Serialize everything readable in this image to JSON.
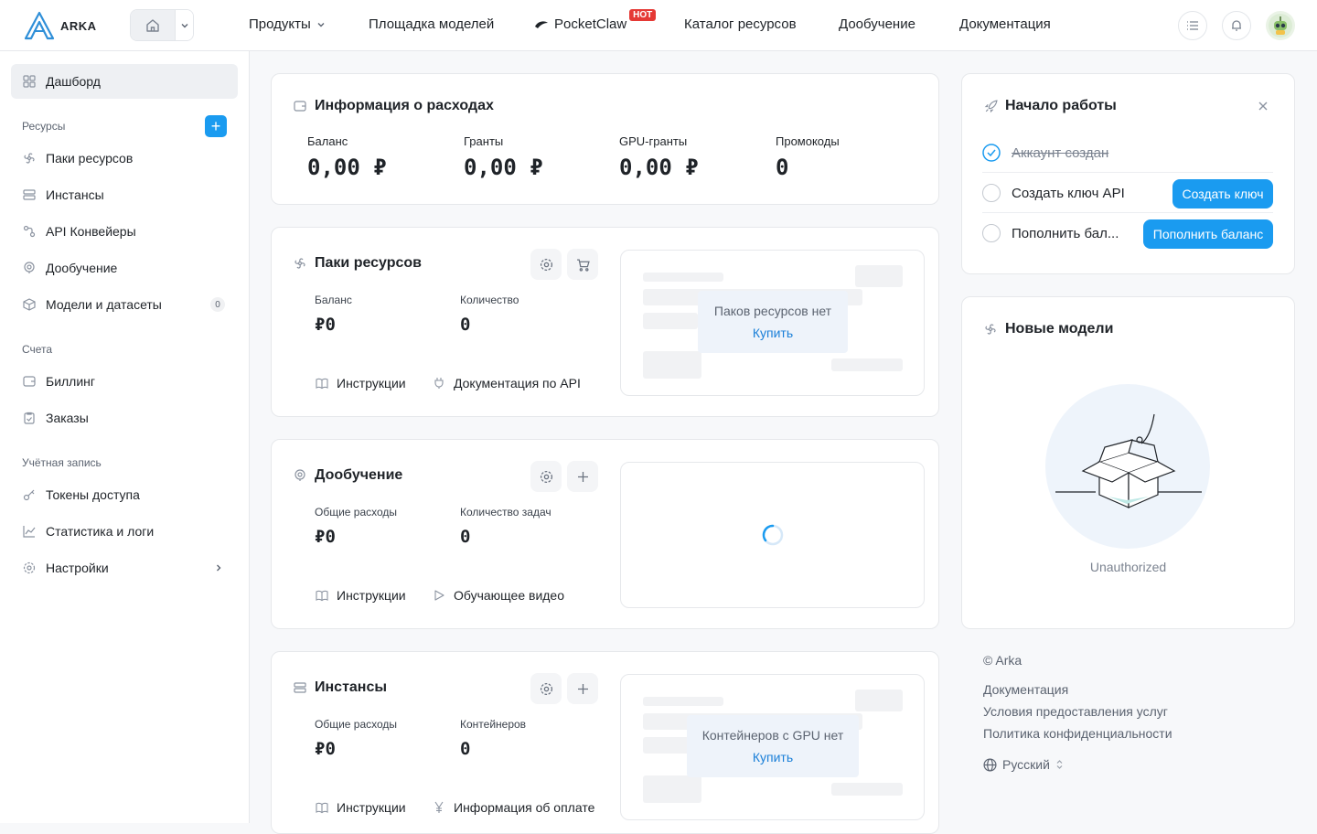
{
  "brand": {
    "name": "ARKA",
    "accent": "#1a9bf0"
  },
  "nav": {
    "products": "Продукты",
    "models": "Площадка моделей",
    "pocketclaw": "PocketClaw",
    "hot": "HOT",
    "catalog": "Каталог ресурсов",
    "finetune": "Дообучение",
    "docs": "Документация"
  },
  "sidebar": {
    "dashboard": "Дашборд",
    "resources_section": "Ресурсы",
    "resource_packs": "Паки ресурсов",
    "instances": "Инстансы",
    "api_pipelines": "API Конвейеры",
    "finetune": "Дообучение",
    "models_datasets": "Модели и датасеты",
    "models_count": "0",
    "accounts_section": "Счета",
    "billing": "Биллинг",
    "orders": "Заказы",
    "account_section": "Учётная запись",
    "tokens": "Токены доступа",
    "stats": "Статистика и логи",
    "settings": "Настройки"
  },
  "expenses": {
    "title": "Информация о расходах",
    "balance_label": "Баланс",
    "balance": "0,00 ₽",
    "grants_label": "Гранты",
    "grants": "0,00 ₽",
    "gpu_grants_label": "GPU-гранты",
    "gpu_grants": "0,00 ₽",
    "promo_label": "Промокоды",
    "promo": "0"
  },
  "packs": {
    "title": "Паки ресурсов",
    "balance_label": "Баланс",
    "balance": "₽0",
    "count_label": "Количество",
    "count": "0",
    "instructions": "Инструкции",
    "api_docs": "Документация по API",
    "empty": "Паков ресурсов нет",
    "buy": "Купить"
  },
  "finetune": {
    "title": "Дообучение",
    "total_label": "Общие расходы",
    "total": "₽0",
    "tasks_label": "Количество задач",
    "tasks": "0",
    "instructions": "Инструкции",
    "video": "Обучающее видео"
  },
  "instances": {
    "title": "Инстансы",
    "total_label": "Общие расходы",
    "total": "₽0",
    "containers_label": "Контейнеров",
    "containers": "0",
    "instructions": "Инструкции",
    "payment_info": "Информация об оплате",
    "empty": "Контейнеров с GPU нет",
    "buy": "Купить"
  },
  "onboarding": {
    "title": "Начало работы",
    "step1": "Аккаунт создан",
    "step2": "Создать ключ API",
    "step2_btn": "Создать ключ",
    "step3": "Пополнить бал...",
    "step3_btn": "Пополнить баланс"
  },
  "new_models": {
    "title": "Новые модели",
    "status": "Unauthorized"
  },
  "footer": {
    "copyright": "© Arka",
    "docs": "Документация",
    "terms": "Условия предоставления услуг",
    "privacy": "Политика конфиденциальности",
    "language": "Русский"
  }
}
